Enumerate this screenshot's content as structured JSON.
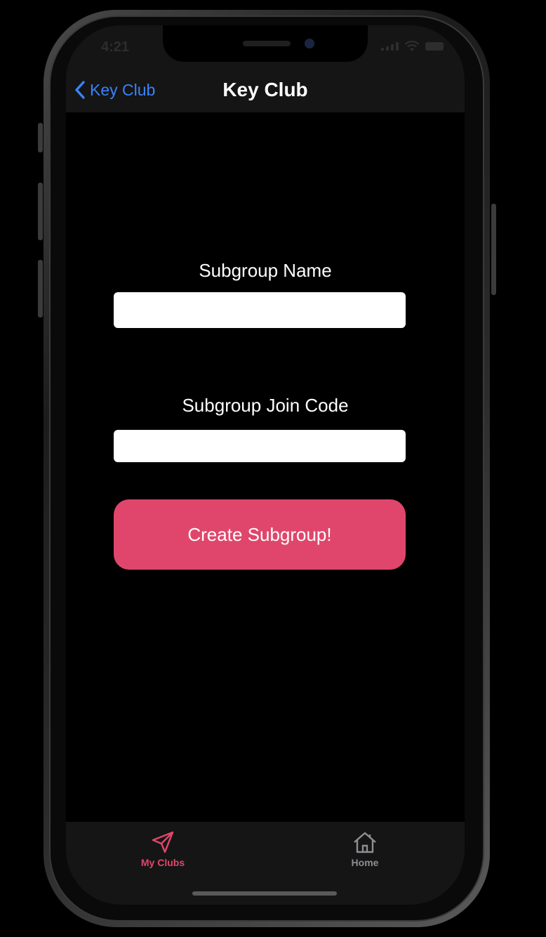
{
  "colors": {
    "accent": "#e0466b",
    "link": "#3a82f7",
    "background": "#000000",
    "bar": "#151515",
    "inactive_tab": "#8e8e93"
  },
  "status_bar": {
    "time": "4:21"
  },
  "nav": {
    "back_label": "Key Club",
    "title": "Key Club"
  },
  "form": {
    "name_label": "Subgroup Name",
    "name_value": "",
    "code_label": "Subgroup Join Code",
    "code_value": "",
    "submit_label": "Create Subgroup!"
  },
  "tab_bar": {
    "items": [
      {
        "label": "My Clubs",
        "icon": "paper-plane-icon",
        "selected": true
      },
      {
        "label": "Home",
        "icon": "house-icon",
        "selected": false
      }
    ]
  }
}
